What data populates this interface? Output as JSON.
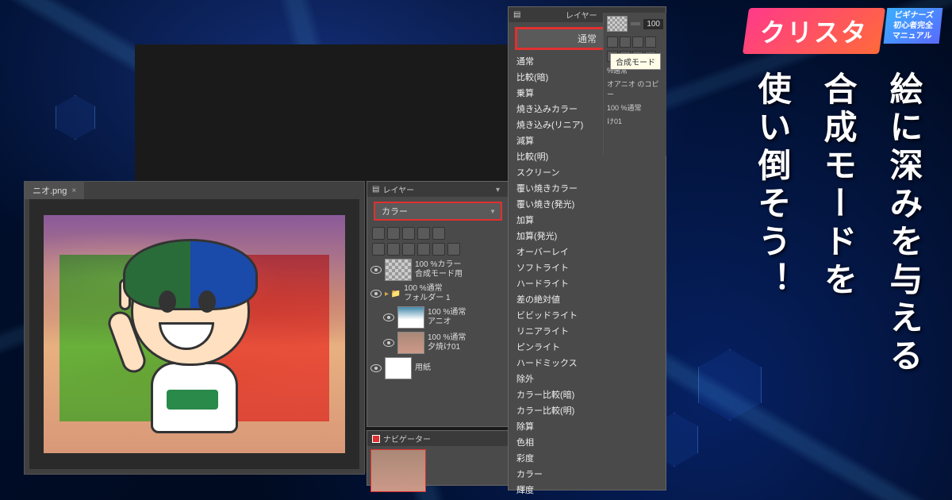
{
  "logo": {
    "brand": "クリスタ",
    "sub1": "ビギナーズ",
    "sub2": "初心者完全",
    "sub3": "マニュアル"
  },
  "headline": {
    "line1": "絵に深みを与える",
    "line2": "合成モードを",
    "line3": "使い倒そう！"
  },
  "tab": {
    "filename": "ニオ.png",
    "close": "×"
  },
  "panel_left": {
    "title": "レイヤー",
    "selected_mode": "カラー",
    "layers": [
      {
        "name": "100 %カラー",
        "sub": "合成モード用"
      },
      {
        "name": "100 %通常",
        "sub": "フォルダー 1"
      },
      {
        "name": "100 %通常",
        "sub": "アニオ"
      },
      {
        "name": "100 %通常",
        "sub": "夕焼け01"
      },
      {
        "name": "用紙",
        "sub": ""
      }
    ]
  },
  "navigator": {
    "title": "ナビゲーター"
  },
  "panel_right": {
    "title": "レイヤー",
    "selected_mode": "通常",
    "tooltip": "合成モード",
    "opacity": "100",
    "side_layers": [
      "%通常",
      "オアニオ のコピー",
      "100 %通常",
      "け01"
    ],
    "modes": [
      "通常",
      "比較(暗)",
      "乗算",
      "焼き込みカラー",
      "焼き込み(リニア)",
      "減算",
      "比較(明)",
      "スクリーン",
      "覆い焼きカラー",
      "覆い焼き(発光)",
      "加算",
      "加算(発光)",
      "オーバーレイ",
      "ソフトライト",
      "ハードライト",
      "差の絶対値",
      "ビビッドライト",
      "リニアライト",
      "ピンライト",
      "ハードミックス",
      "除外",
      "カラー比較(暗)",
      "カラー比較(明)",
      "除算",
      "色相",
      "彩度",
      "カラー",
      "輝度"
    ]
  }
}
